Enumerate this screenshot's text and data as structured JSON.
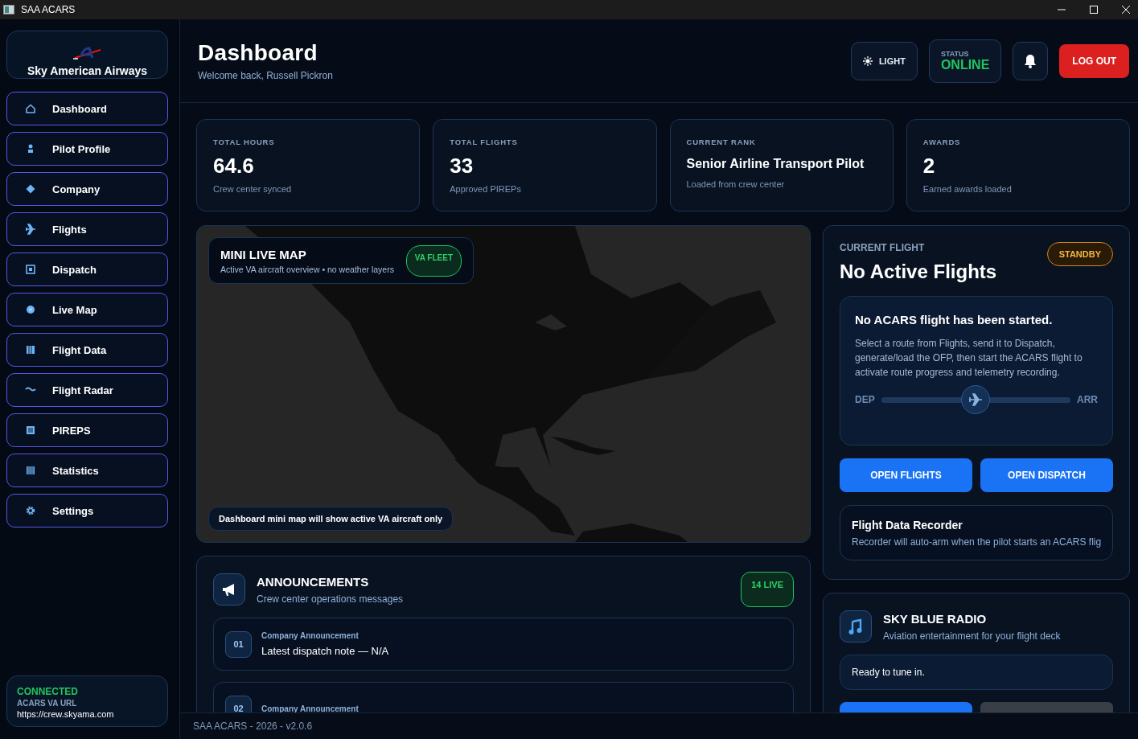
{
  "window": {
    "title": "SAA ACARS"
  },
  "sidebar": {
    "brand": "Sky American Airways",
    "items": [
      {
        "label": "Dashboard",
        "selected": false
      },
      {
        "label": "Pilot Profile",
        "selected": false
      },
      {
        "label": "Company",
        "selected": false
      },
      {
        "label": "Flights",
        "selected": false
      },
      {
        "label": "Dispatch",
        "selected": false
      },
      {
        "label": "Live Map",
        "selected": false
      },
      {
        "label": "Flight Data",
        "selected": false
      },
      {
        "label": "Flight Radar",
        "selected": false
      },
      {
        "label": "PIREPS",
        "selected": false
      },
      {
        "label": "Statistics",
        "selected": false
      },
      {
        "label": "Settings",
        "selected": false
      }
    ],
    "connection": {
      "status": "CONNECTED",
      "label": "ACARS VA URL",
      "url": "https://crew.skyama.com"
    }
  },
  "header": {
    "title": "Dashboard",
    "subtitle": "Welcome back, Russell Pickron",
    "theme_button": "LIGHT",
    "status_label": "STATUS",
    "status": "ONLINE",
    "logout_button": "LOG OUT"
  },
  "stats": [
    {
      "label": "TOTAL HOURS",
      "value": "64.6",
      "note": "Crew center synced"
    },
    {
      "label": "TOTAL FLIGHTS",
      "value": "33",
      "note": "Approved PIREPs"
    },
    {
      "label": "CURRENT RANK",
      "value": "Senior Airline Transport Pilot",
      "note": "Loaded from crew center"
    },
    {
      "label": "AWARDS",
      "value": "2",
      "note": "Earned awards loaded"
    }
  ],
  "map": {
    "title": "MINI LIVE MAP",
    "subtitle": "Active VA aircraft overview • no weather layers",
    "badge": "VA FLEET",
    "note": "Dashboard mini map will show active VA aircraft only"
  },
  "announcements": {
    "title": "ANNOUNCEMENTS",
    "subtitle": "Crew center operations messages",
    "badge": "14 LIVE",
    "items": [
      {
        "number": "01",
        "category": "Company Announcement",
        "text": "Latest dispatch note — N/A"
      },
      {
        "number": "02",
        "category": "Company Announcement"
      }
    ]
  },
  "current_flight": {
    "label": "CURRENT FLIGHT",
    "title": "No Active Flights",
    "badge": "STANDBY",
    "message_title": "No ACARS flight has been started.",
    "message": "Select a route from Flights, send it to Dispatch, generate/load the OFP, then start the ACARS flight to activate route progress and telemetry recording.",
    "route": {
      "from": "DEP",
      "to": "ARR",
      "level": 0.5
    },
    "buttons": [
      "OPEN FLIGHTS",
      "OPEN DISPATCH"
    ],
    "recorder": {
      "title": "Flight Data Recorder",
      "text": "Recorder will auto-arm when the pilot starts an ACARS flig"
    }
  },
  "radio": {
    "title": "SKY BLUE RADIO",
    "subtitle": "Aviation entertainment for your flight deck",
    "status": "Ready to tune in."
  },
  "footer": "SAA ACARS - 2026 - v2.0.6"
}
